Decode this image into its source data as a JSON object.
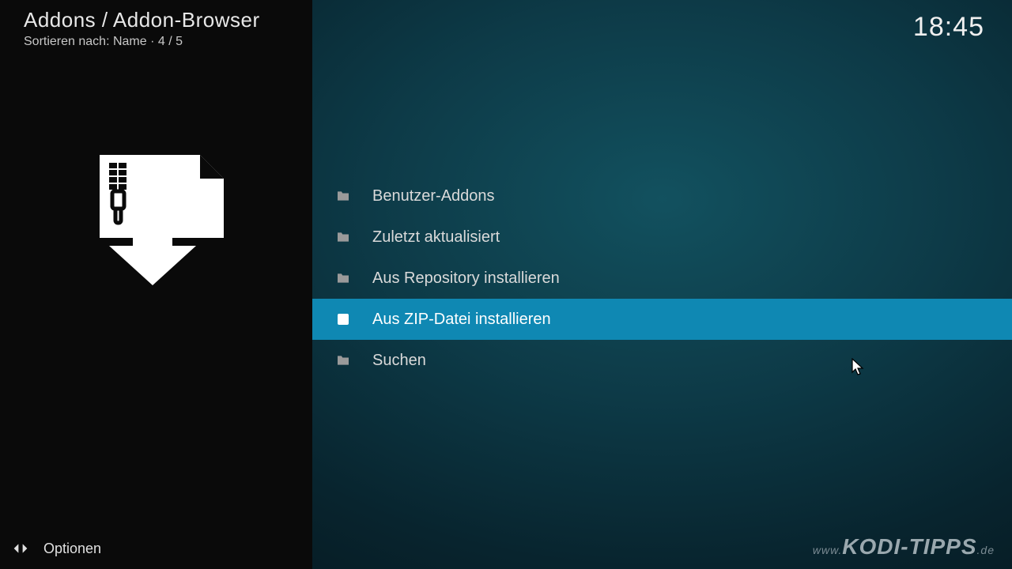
{
  "header": {
    "breadcrumb": "Addons / Addon-Browser",
    "sort_label": "Sortieren nach: Name  ·  4 / 5",
    "clock": "18:45"
  },
  "list": {
    "items": [
      {
        "label": "Benutzer-Addons",
        "icon": "folder",
        "selected": false
      },
      {
        "label": "Zuletzt aktualisiert",
        "icon": "folder",
        "selected": false
      },
      {
        "label": "Aus Repository installieren",
        "icon": "folder",
        "selected": false
      },
      {
        "label": "Aus ZIP-Datei installieren",
        "icon": "zip",
        "selected": true
      },
      {
        "label": "Suchen",
        "icon": "folder",
        "selected": false
      }
    ]
  },
  "footer": {
    "options_label": "Optionen"
  },
  "watermark": {
    "prefix": "www.",
    "brand": "KODI-TIPPS",
    "suffix": ".de"
  }
}
